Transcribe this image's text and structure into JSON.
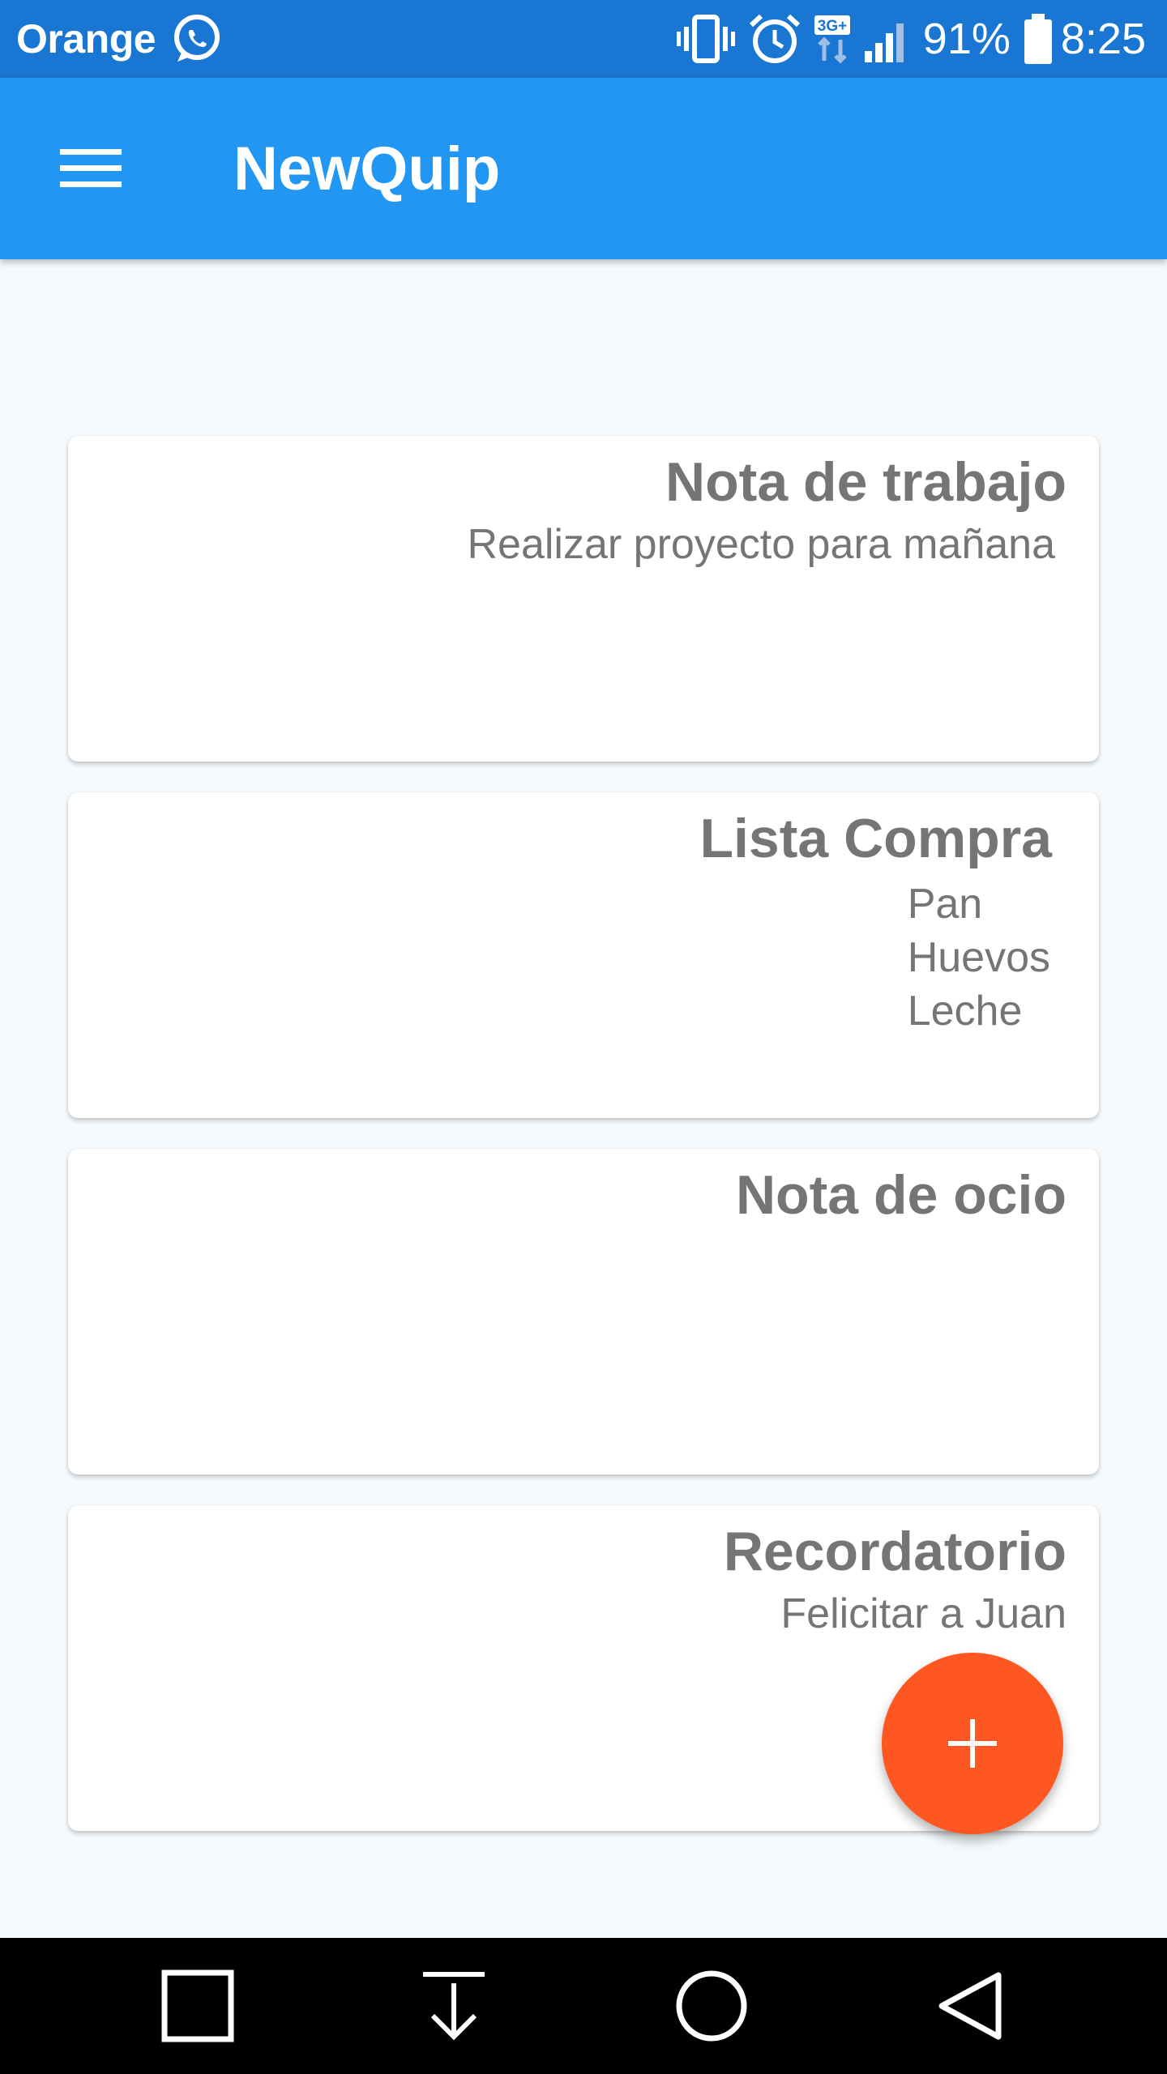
{
  "status_bar": {
    "carrier": "Orange",
    "battery": "91%",
    "time": "8:25",
    "network": "3G+",
    "icons": [
      "whatsapp-icon",
      "vibrate-icon",
      "alarm-icon",
      "network-3g-icon",
      "signal-icon",
      "battery-icon"
    ]
  },
  "app_bar": {
    "title": "NewQuip",
    "menu_icon": "menu-icon"
  },
  "notes": [
    {
      "title": "Nota de trabajo",
      "body": "Realizar proyecto para mañana"
    },
    {
      "title": "Lista Compra",
      "items": [
        "Pan",
        "Huevos",
        "Leche"
      ]
    },
    {
      "title": "Nota de ocio"
    },
    {
      "title": "Recordatorio",
      "body": "Felicitar a Juan"
    }
  ],
  "fab": {
    "icon": "plus-icon",
    "color": "#ff5722"
  },
  "nav_bar": {
    "buttons": [
      "recent-apps-icon",
      "notification-pull-icon",
      "home-icon",
      "back-icon"
    ]
  },
  "colors": {
    "status_bar": "#1976d2",
    "app_bar": "#2196f3",
    "accent": "#ff5722",
    "text_gray": "#757575"
  }
}
